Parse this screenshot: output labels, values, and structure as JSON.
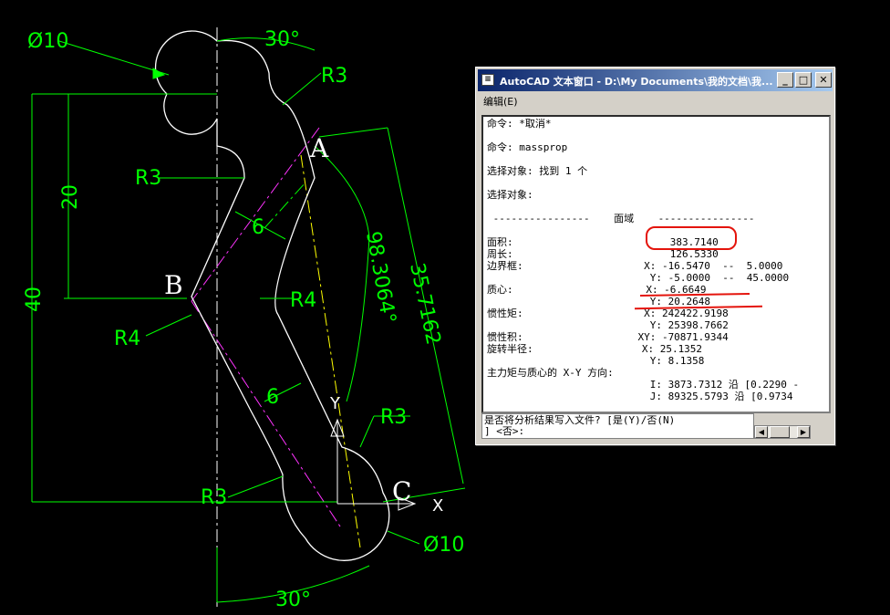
{
  "drawing": {
    "dims": {
      "d10_top": "Ø10",
      "ang30_top": "30°",
      "r3_top_right": "R3",
      "r3_left": "R3",
      "dim20": "20",
      "dim40": "40",
      "dim6_upper": "6",
      "r4_right": "R4",
      "r4_left": "R4",
      "ang98": "98.3064°",
      "dim35": "35.7162",
      "dim6_lower": "6",
      "r3_lower_right": "R3",
      "r3_bottom": "R3",
      "d10_bottom": "Ø10",
      "ang30_bottom": "30°"
    },
    "points": {
      "a": "A",
      "b": "B",
      "c": "C"
    },
    "ucs": {
      "x": "X",
      "y": "Y"
    }
  },
  "window": {
    "title": "AutoCAD 文本窗口 - D:\\My Documents\\我的文档\\我...",
    "menu": "编辑(E)",
    "lines": {
      "l1": "命令: *取消*",
      "l2": "命令: massprop",
      "l3": "选择对象: 找到 1 个",
      "l4": "选择对象:",
      "l5": " ----------------    面域    ----------------",
      "l6": "面积:                          383.7140",
      "l7": "周长:                          126.5330",
      "l8": "边界框:                    X: -16.5470  --  5.0000",
      "l9": "                           Y: -5.0000  --  45.0000",
      "l10": "质心:                      X: -6.6649",
      "l11": "                           Y: 20.2648",
      "l12": "惯性矩:                    X: 242422.9198",
      "l13": "                           Y: 25398.7662",
      "l14": "惯性积:                   XY: -70871.9344",
      "l15": "旋转半径:                  X: 25.1352",
      "l16": "                           Y: 8.1358",
      "l17": "主力矩与质心的 X-Y 方向:",
      "l18": "                           I: 3873.7312 沿 [0.2290 -",
      "l19": "                           J: 89325.5793 沿 [0.9734"
    },
    "prompt1": "是否将分析结果写入文件? [是(Y)/否(N)",
    "prompt2": "] <否>:",
    "controls": {
      "minimize": "_",
      "maximize": "□",
      "close": "✕"
    }
  }
}
